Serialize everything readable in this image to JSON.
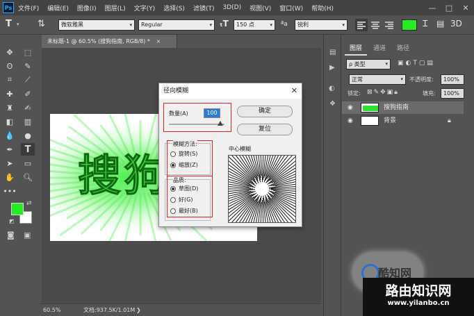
{
  "app": {
    "logo_text": "Ps"
  },
  "menu": [
    "文件(F)",
    "编辑(E)",
    "图像(I)",
    "图层(L)",
    "文字(Y)",
    "选择(S)",
    "滤镜(T)",
    "3D(D)",
    "视图(V)",
    "窗口(W)",
    "帮助(H)"
  ],
  "window_controls": [
    "—",
    "□",
    "✕"
  ],
  "options_bar": {
    "tool_glyph": "T",
    "font_family": "微软雅黑",
    "font_style": "Regular",
    "font_size": "150 点",
    "aa_label": "ªa",
    "antialias": "锐利",
    "text_color": "#22ee22"
  },
  "document": {
    "tab_title": "未标题-1 @ 60.5% (搜狗指南, RGB/8) *",
    "close_glyph": "×",
    "canvas_text": "搜狗",
    "zoom": "60.5%",
    "doc_size": "文档:937.5K/1.01M"
  },
  "colors": {
    "foreground": "#22ee22",
    "background": "#ffffff",
    "glow": "#33ee33"
  },
  "layers_panel": {
    "tabs": [
      "图层",
      "通道",
      "路径"
    ],
    "filter_kind": "ρ 类型",
    "blend_mode": "正常",
    "opacity_label": "不透明度:",
    "opacity_value": "100%",
    "lock_label": "锁定:",
    "fill_label": "填充:",
    "fill_value": "100%",
    "layers": [
      {
        "name": "搜狗指南",
        "selected": true
      },
      {
        "name": "背景",
        "selected": false,
        "locked": true
      }
    ]
  },
  "dialog": {
    "title": "径向模糊",
    "close_glyph": "✕",
    "amount_label": "数量(A)",
    "amount_value": "100",
    "ok_label": "确定",
    "reset_label": "复位",
    "method_label": "模糊方法:",
    "methods": [
      {
        "label": "旋转(S)",
        "checked": false
      },
      {
        "label": "缩放(Z)",
        "checked": true
      }
    ],
    "quality_label": "品质:",
    "qualities": [
      {
        "label": "草图(D)",
        "checked": true
      },
      {
        "label": "好(G)",
        "checked": false
      },
      {
        "label": "最好(B)",
        "checked": false
      }
    ],
    "center_label": "中心模糊"
  },
  "watermark": {
    "logo_text": "酷知网",
    "site_name": "路由知识网",
    "site_url": "www.yilanbo.cn"
  }
}
